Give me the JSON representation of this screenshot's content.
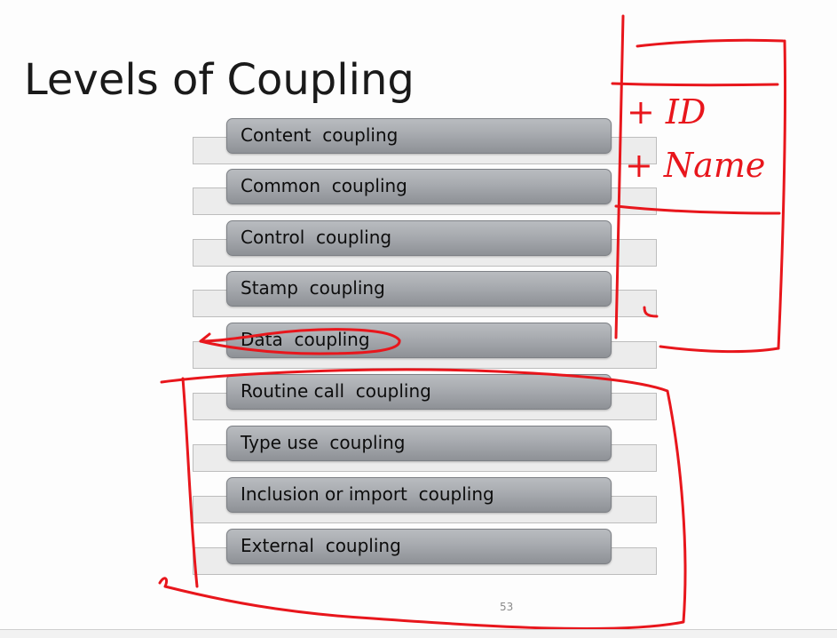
{
  "slide": {
    "title": "Levels of Coupling",
    "page_number": "53",
    "levels": [
      "Content  coupling",
      "Common  coupling",
      "Control  coupling",
      "Stamp  coupling",
      "Data  coupling",
      "Routine call  coupling",
      "Type use  coupling",
      "Inclusion or import  coupling",
      "External  coupling"
    ]
  },
  "annotations": {
    "line_1": "+ ID",
    "line_2": "+ Name",
    "ink_color": "#e8161c"
  }
}
